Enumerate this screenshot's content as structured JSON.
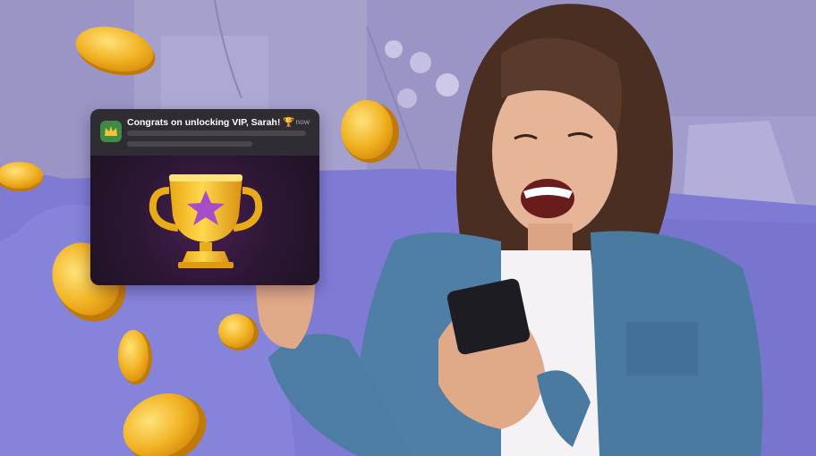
{
  "notification": {
    "title": "Congrats on unlocking VIP, Sarah! 🏆",
    "time": "now",
    "app_icon": "crown-app-icon",
    "image": "trophy-star-icon"
  },
  "colors": {
    "background": "#8f88c4",
    "coin": "#f0b429",
    "trophy": "#f5c430",
    "star": "#b05ad0",
    "notification_bg": "#2f2c33"
  }
}
